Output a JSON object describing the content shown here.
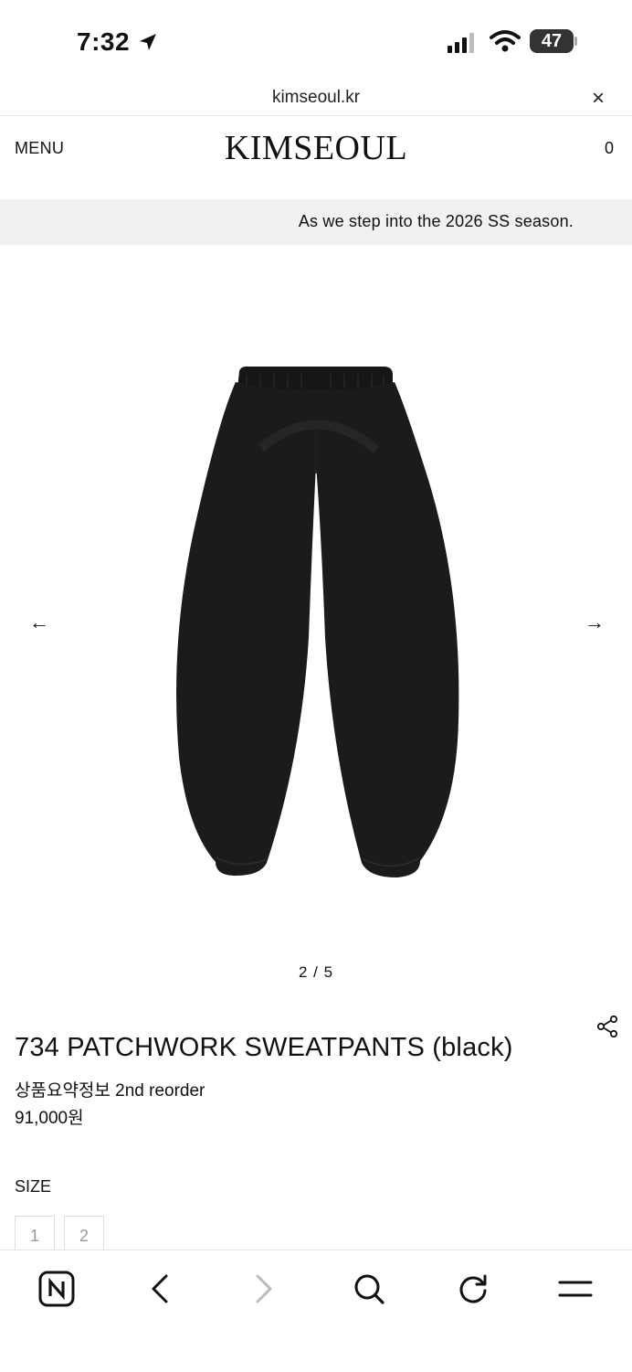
{
  "status_bar": {
    "time": "7:32",
    "battery": "47"
  },
  "browser": {
    "url": "kimseoul.kr",
    "close_icon": "×"
  },
  "header": {
    "menu_label": "MENU",
    "logo": "KIMSEOUL",
    "cart_count": "0"
  },
  "notice": {
    "text": "As we step into the 2026 SS season."
  },
  "gallery": {
    "prev": "←",
    "next": "→",
    "counter": "2 / 5"
  },
  "product": {
    "title": "734 PATCHWORK SWEATPANTS (black)",
    "subtitle": "상품요약정보 2nd reorder",
    "price": "91,000원",
    "size_label": "SIZE",
    "sizes": [
      "1",
      "2"
    ]
  },
  "colors": {
    "notice_bg": "#f1f1f1",
    "product": "#1b1b1b"
  }
}
